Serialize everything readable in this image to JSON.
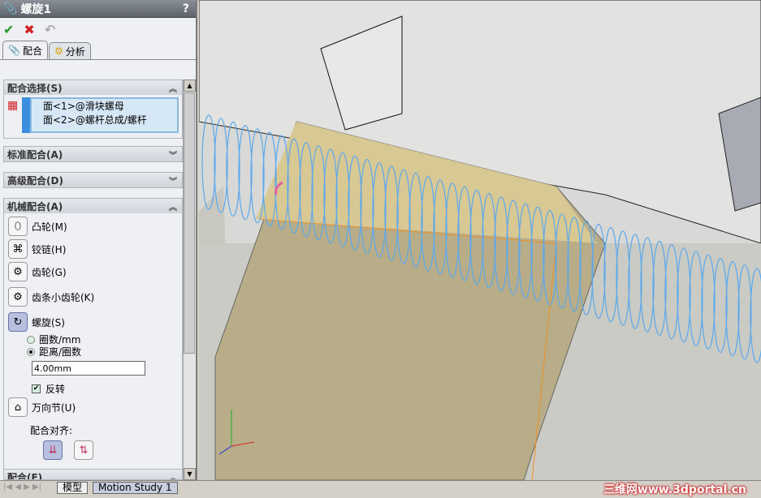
{
  "panel": {
    "title": "螺旋1",
    "help": "?",
    "tabs": [
      {
        "label": "配合",
        "icon": "paperclip-icon"
      },
      {
        "label": "分析",
        "icon": "analysis-icon"
      }
    ],
    "mate_selection": {
      "title": "配合选择(S)",
      "items": [
        "面<1>@滑块螺母",
        "面<2>@螺杆总成/螺杆"
      ]
    },
    "standard": {
      "title": "标准配合(A)"
    },
    "advanced": {
      "title": "高级配合(D)"
    },
    "mechanical": {
      "title": "机械配合(A)",
      "items": [
        {
          "label": "凸轮(M)",
          "icon": "cam-icon"
        },
        {
          "label": "铰链(H)",
          "icon": "hinge-icon"
        },
        {
          "label": "齿轮(G)",
          "icon": "gear-icon"
        },
        {
          "label": "齿条小齿轮(K)",
          "icon": "rack-pinion-icon"
        },
        {
          "label": "螺旋(S)",
          "icon": "screw-icon",
          "selected": true
        }
      ],
      "radio": [
        {
          "label": "圈数/mm",
          "checked": false
        },
        {
          "label": "距离/圈数",
          "checked": true
        }
      ],
      "distance": "4.00mm",
      "reverse": {
        "label": "反转",
        "checked": true
      },
      "universal": "万向节(U)",
      "alignment_label": "配合对齐:"
    },
    "mates": {
      "title": "配合(E)"
    }
  },
  "bottom": {
    "tabs": [
      "模型",
      "Motion Study 1"
    ]
  },
  "watermark": "三维网www.3dportal.cn",
  "colors": {
    "helix": "#5aa8ee",
    "part": "#c8b888",
    "accent": "#3b8ee0"
  }
}
